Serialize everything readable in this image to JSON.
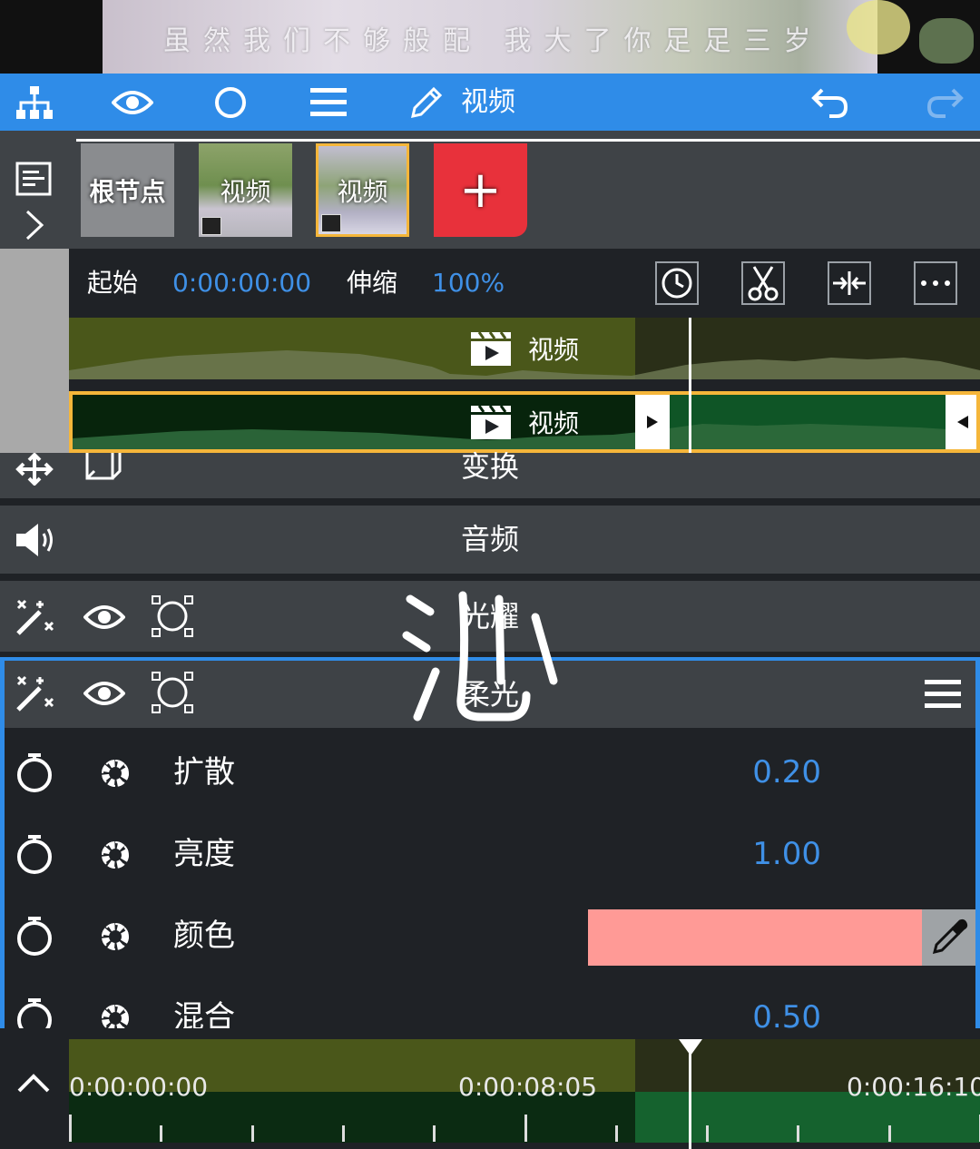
{
  "preview": {
    "caption": "虽然我们不够般配 我大了你足足三岁"
  },
  "toolbar": {
    "title": "视频"
  },
  "nodes": {
    "root_label": "根节点",
    "video1_label": "视频",
    "video2_label": "视频",
    "add_label": "+"
  },
  "clip": {
    "start_label": "起始",
    "start_value": "0:00:00:00",
    "stretch_label": "伸缩",
    "stretch_value": "100%"
  },
  "tracks": [
    {
      "label": "视频"
    },
    {
      "label": "视频"
    }
  ],
  "panels": {
    "transform": "变换",
    "audio": "音频",
    "glow": "光耀",
    "softlight": "柔光"
  },
  "params": [
    {
      "label": "扩散",
      "value": "0.20"
    },
    {
      "label": "亮度",
      "value": "1.00"
    },
    {
      "label": "颜色",
      "color": "#ff9a96"
    },
    {
      "label": "混合",
      "value": "0.50"
    }
  ],
  "timeline": {
    "tc_start": "0:00:00:00",
    "tc_mid": "0:00:08:05",
    "tc_end": "0:00:16:10"
  },
  "watermark": "沁",
  "colors": {
    "accent": "#2f8ce8",
    "selection": "#f5b63a",
    "add": "#e8313b",
    "value": "#3f90e6"
  }
}
